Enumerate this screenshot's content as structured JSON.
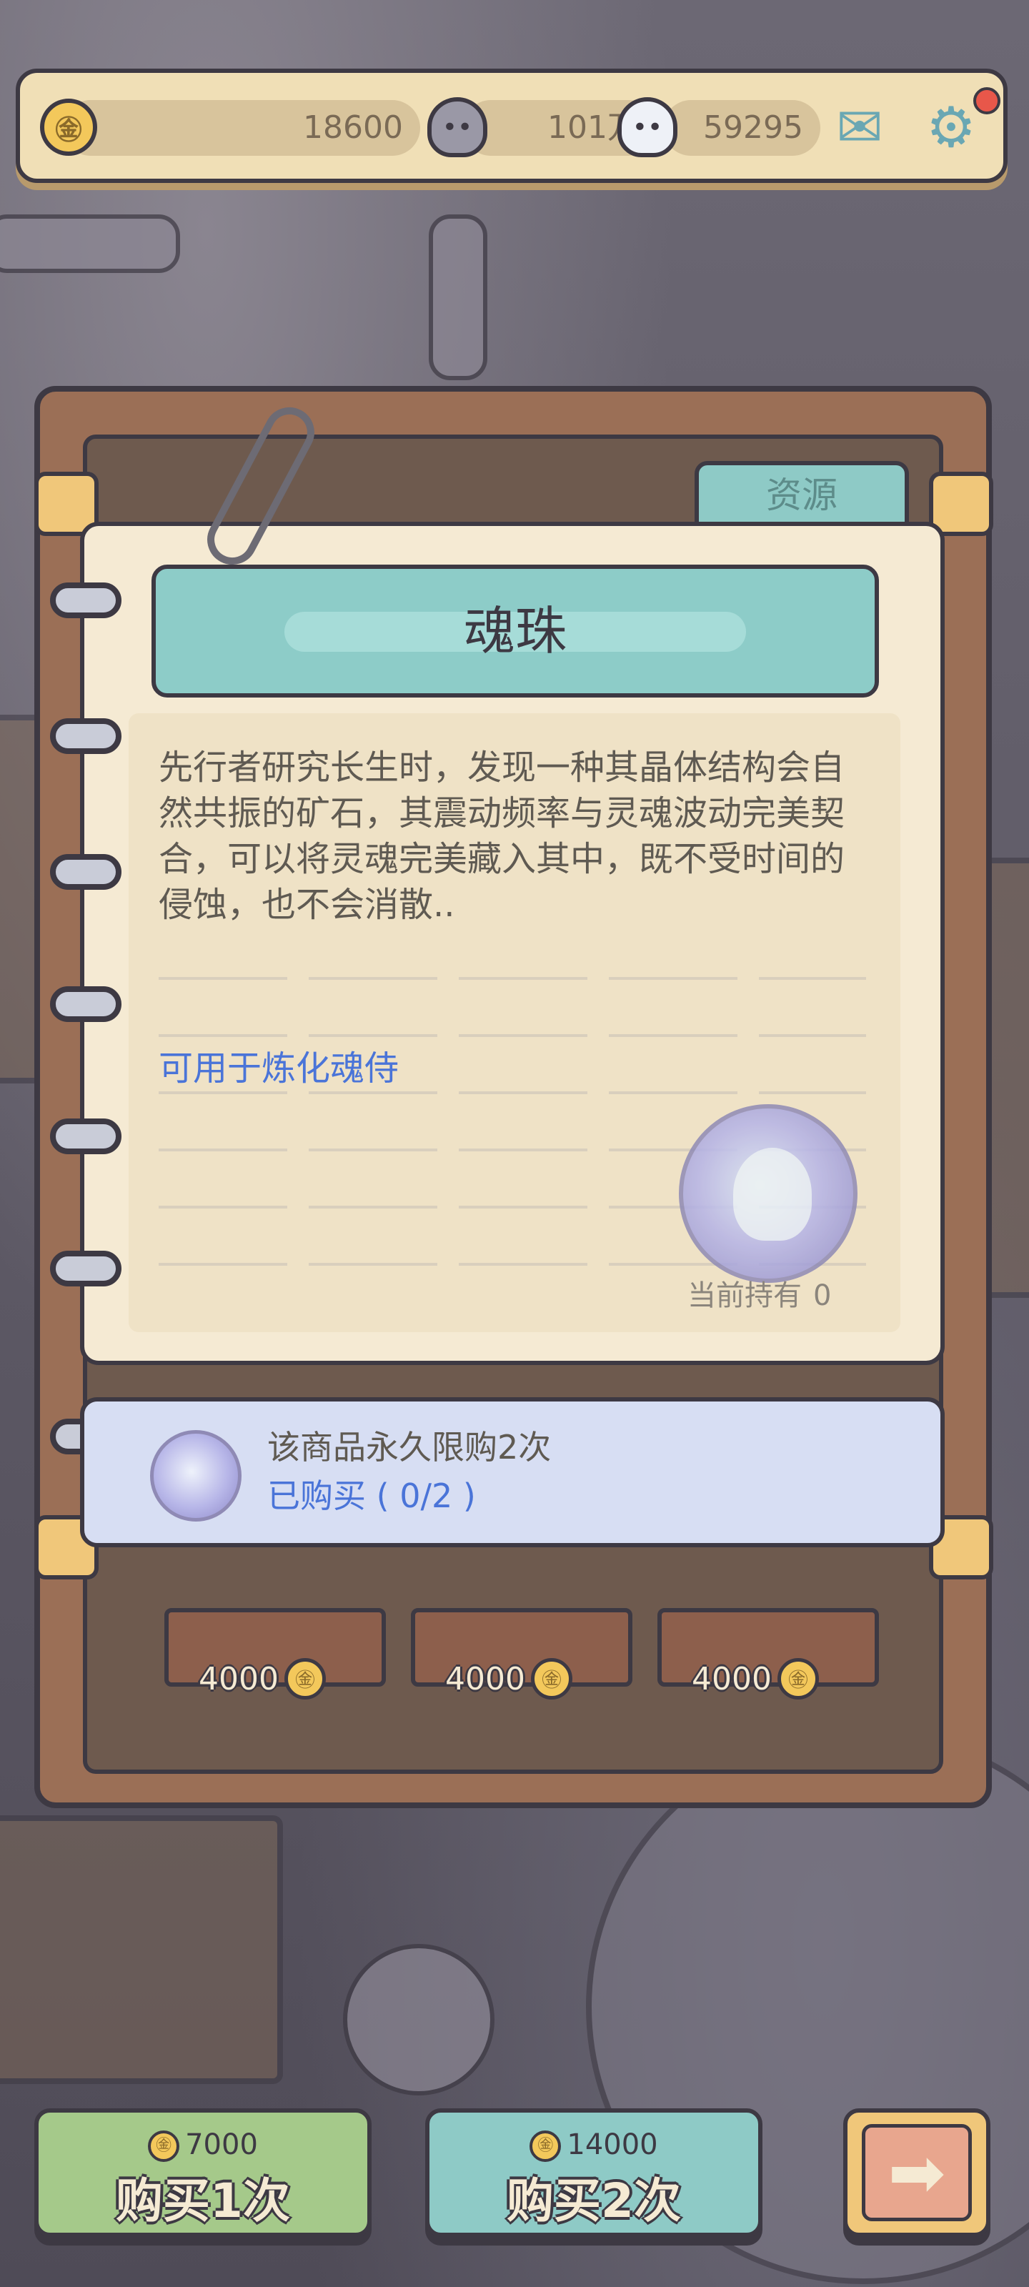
{
  "currency": {
    "coins": "18600",
    "ghost_dark": "101万",
    "ghost_light": "59295"
  },
  "icons": {
    "coin": "coin-icon",
    "coin_glyph": "㊎",
    "ghost_dark": "dark-ghost-icon",
    "ghost_light": "light-ghost-icon",
    "mail": "mail-icon",
    "mail_glyph": "✉",
    "settings": "gear-icon",
    "settings_glyph": "⚙",
    "arrow_glyph": "➡"
  },
  "tab_label": "资源",
  "item": {
    "name": "魂珠",
    "description": "先行者研究长生时，发现一种其晶体结构会自然共振的矿石，其震动频率与灵魂波动完美契合，可以将灵魂完美藏入其中，既不受时间的侵蚀，也不会消散..",
    "usage": "可用于炼化魂侍",
    "holding_label": "当前持有",
    "holding_count": "0"
  },
  "purchase_limit": {
    "line1": "该商品永久限购2次",
    "line2": "已购买 ( 0/2 )"
  },
  "shelf_prices": [
    "4000",
    "4000",
    "4000"
  ],
  "buttons": {
    "buy1_cost": "7000",
    "buy1_label": "购买1次",
    "buy2_cost": "14000",
    "buy2_label": "购买2次"
  },
  "colors": {
    "accent_teal": "#8dccc8",
    "buy1_green": "#a5c98a",
    "buy2_teal": "#8ecac6",
    "link_blue": "#4a74d8"
  }
}
